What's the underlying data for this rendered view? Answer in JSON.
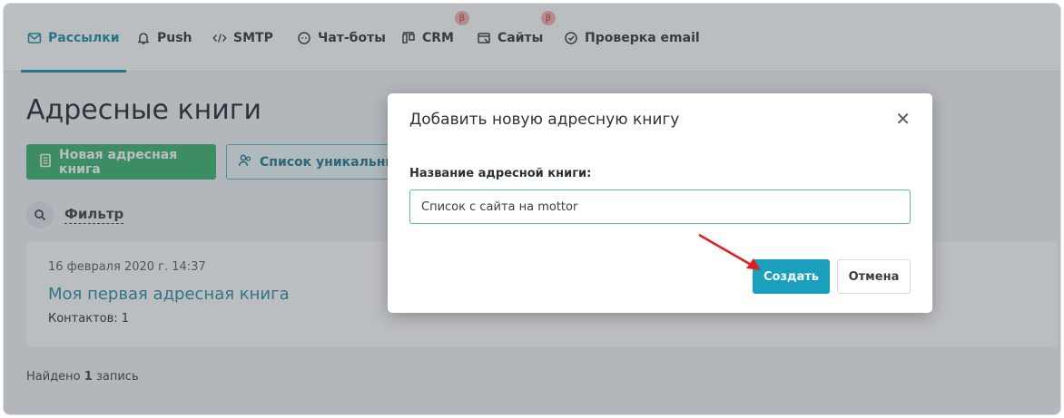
{
  "nav": {
    "tabs": [
      {
        "label": "Рассылки",
        "icon": "mail-icon",
        "active": true
      },
      {
        "label": "Push",
        "icon": "bell-icon"
      },
      {
        "label": "SMTP",
        "icon": "code-icon"
      },
      {
        "label": "Чат-боты",
        "icon": "chatbot-icon"
      },
      {
        "label": "CRM",
        "icon": "crm-icon",
        "badge": "β"
      },
      {
        "label": "Сайты",
        "icon": "site-icon",
        "badge": "β"
      },
      {
        "label": "Проверка email",
        "icon": "check-circle-icon"
      }
    ]
  },
  "page": {
    "title": "Адресные книги",
    "new_book_button": "Новая адресная книга",
    "unique_list_button": "Список уникальных",
    "filter_label": "Фильтр",
    "book": {
      "date": "16 февраля 2020 г. 14:37",
      "name": "Моя первая адресная книга",
      "contacts": "Контактов: 1"
    },
    "found_prefix": "Найдено",
    "found_count": "1",
    "found_suffix": "запись"
  },
  "modal": {
    "title": "Добавить новую адресную книгу",
    "field_label": "Название адресной книги:",
    "field_value": "Список с сайта на mottor",
    "create_button": "Создать",
    "cancel_button": "Отмена"
  },
  "colors": {
    "accent": "#1d8fa5",
    "green_button": "#3cb371",
    "create_button": "#1aa0bd",
    "annotation_arrow": "#e02020"
  }
}
